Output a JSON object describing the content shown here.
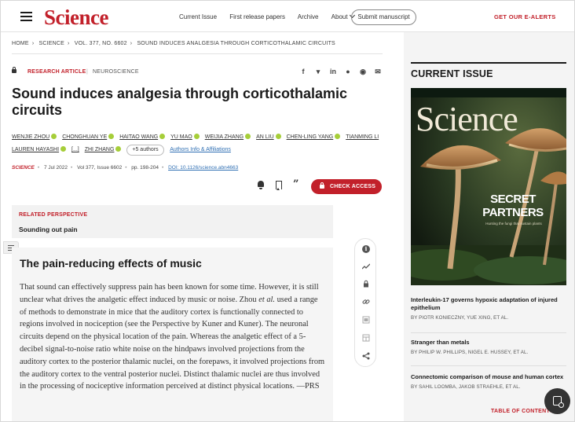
{
  "header": {
    "logo": "Science",
    "nav": [
      "Current Issue",
      "First release papers",
      "Archive",
      "About"
    ],
    "submit_label": "Submit manuscript",
    "alerts_label": "GET OUR E-ALERTS"
  },
  "breadcrumb": [
    "HOME",
    "SCIENCE",
    "VOL. 377, NO. 6602",
    "SOUND INDUCES ANALGESIA THROUGH CORTICOTHALAMIC CIRCUITS"
  ],
  "article": {
    "type": "RESEARCH ARTICLE",
    "subject": "NEUROSCIENCE",
    "share_icons": [
      "facebook-icon",
      "twitter-icon",
      "linkedin-icon",
      "reddit-icon",
      "wechat-icon",
      "email-icon"
    ],
    "title": "Sound induces analgesia through corticothalamic circuits",
    "authors": [
      "WENJIE ZHOU",
      "CHONGHUAN YE",
      "HAITAO WANG",
      "YU MAO",
      "WEIJIA ZHANG",
      "AN LIU",
      "CHEN-LING YANG",
      "TIANMING LI",
      "LAUREN HAYASHI",
      "[...]",
      "ZHI ZHANG"
    ],
    "more_authors": "+5 authors",
    "affiliations_link": "Authors Info & Affiliations",
    "journal": "SCIENCE",
    "date": "7 Jul 2022",
    "volume": "Vol 377, Issue 6602",
    "pages": "pp. 198-204",
    "doi": "DOI: 10.1126/science.abn4663",
    "check_access": "CHECK ACCESS"
  },
  "related": {
    "label": "RELATED PERSPECTIVE",
    "title": "Sounding out pain"
  },
  "abstract": {
    "heading": "The pain-reducing effects of music",
    "text_1": "That sound can effectively suppress pain has been known for some time. However, it is still unclear what drives the analgetic effect induced by music or noise. Zhou ",
    "text_etal": "et al.",
    "text_2": " used a range of methods to demonstrate in mice that the auditory cortex is functionally connected to regions involved in nociception (see the Perspective by Kuner and Kuner). The neuronal circuits depend on the physical location of the pain. Whereas the analgetic effect of a 5-decibel signal-to-noise ratio white noise on the hindpaws involved projections from the auditory cortex to the posterior thalamic nuclei, on the forepaws, it involved projections from the auditory cortex to the ventral posterior nuclei. Distinct thalamic nuclei are thus involved in the processing of nociceptive information perceived at distinct physical locations. —PRS"
  },
  "sidebar": {
    "heading": "CURRENT ISSUE",
    "cover": {
      "logo": "Science",
      "headline": "SECRET PARTNERS",
      "subhead": "Hunting the fungi that sustain plants"
    },
    "stories": [
      {
        "title": "Interleukin-17 governs hypoxic adaptation of injured epithelium",
        "authors": "BY PIOTR KONIECZNY, YUE XING, ET AL."
      },
      {
        "title": "Stranger than metals",
        "authors": "BY PHILIP W. PHILLIPS, NIGEL E. HUSSEY, ET AL."
      },
      {
        "title": "Connectomic comparison of mouse and human cortex",
        "authors": "BY SAHIL LOOMBA, JAKOB STRAEHLE, ET AL."
      }
    ],
    "toc_label": "TABLE OF CONTENTS"
  },
  "colors": {
    "brand": "#c2202a",
    "orcid": "#a6ce39",
    "link": "#2f6fb3"
  }
}
